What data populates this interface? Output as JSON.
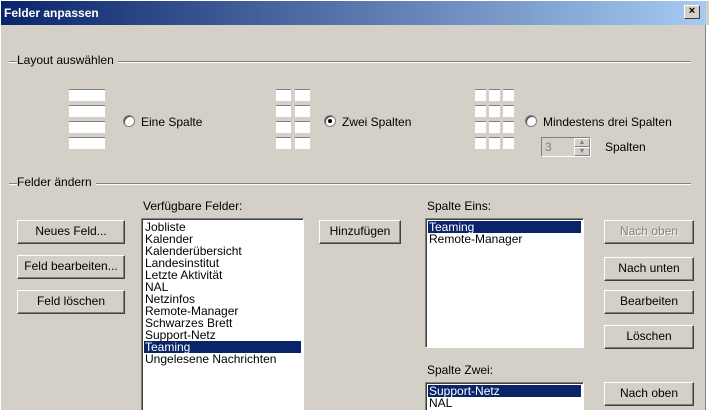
{
  "window": {
    "title": "Felder anpassen",
    "close_glyph": "×"
  },
  "layout_group": {
    "label": "Layout auswählen",
    "options": [
      {
        "label": "Eine Spalte",
        "checked": false
      },
      {
        "label": "Zwei Spalten",
        "checked": true
      },
      {
        "label": "Mindestens drei Spalten",
        "checked": false
      }
    ],
    "columns_value": "3",
    "columns_label": "Spalten"
  },
  "fields_group": {
    "label": "Felder ändern",
    "buttons_left": {
      "new": "Neues Feld...",
      "edit": "Feld bearbeiten...",
      "delete": "Feld löschen"
    },
    "available_label": "Verfügbare Felder:",
    "available_items": [
      "Jobliste",
      "Kalender",
      "Kalenderübersicht",
      "Landesinstitut",
      "Letzte Aktivität",
      "NAL",
      "Netzinfos",
      "Remote-Manager",
      "Schwarzes Brett",
      "Support-Netz",
      "Teaming",
      "Ungelesene Nachrichten"
    ],
    "available_selected": "Teaming",
    "add_button": "Hinzufügen",
    "column1_label": "Spalte Eins:",
    "column1_items": [
      "Teaming",
      "Remote-Manager"
    ],
    "column1_selected": "Teaming",
    "column2_label": "Spalte Zwei:",
    "column2_items": [
      "Support-Netz",
      "NAL"
    ],
    "column2_selected": "Support-Netz",
    "buttons_right": {
      "up": "Nach oben",
      "down": "Nach unten",
      "edit": "Bearbeiten",
      "delete": "Löschen",
      "up2": "Nach oben"
    }
  }
}
